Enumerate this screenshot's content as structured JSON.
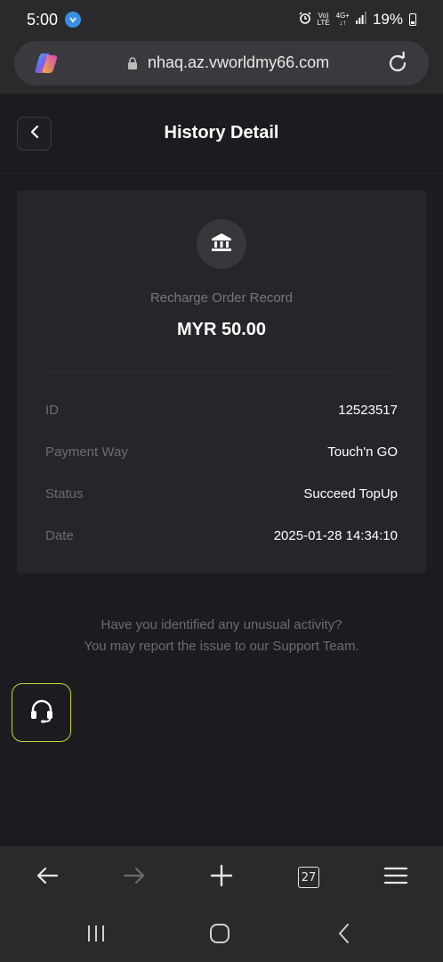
{
  "status_bar": {
    "time": "5:00",
    "network_top": "Vo)",
    "network_bottom": "LTE",
    "net2_top": "4G+",
    "net2_bottom": "↓↑",
    "battery": "19%"
  },
  "browser": {
    "url": "nhaq.az.vworldmy66.com",
    "tab_count": "27"
  },
  "header": {
    "title": "History Detail"
  },
  "record": {
    "type_label": "Recharge Order Record",
    "amount": "MYR 50.00",
    "rows": [
      {
        "label": "ID",
        "value": "12523517"
      },
      {
        "label": "Payment Way",
        "value": "Touch'n GO"
      },
      {
        "label": "Status",
        "value": "Succeed TopUp"
      },
      {
        "label": "Date",
        "value": "2025-01-28 14:34:10"
      }
    ]
  },
  "notice": {
    "line1": "Have you identified any unusual activity?",
    "line2": "You may report the issue to our Support Team."
  },
  "colors": {
    "background": "#1c1c20",
    "card": "#25262a",
    "support_accent": "#c7d63a",
    "muted_text": "#6b6b70"
  },
  "icons": {
    "back": "chevron-left-icon",
    "bank": "bank-icon",
    "support": "headset-icon",
    "reload": "reload-icon",
    "lock": "lock-icon",
    "copilot": "copilot-icon"
  }
}
